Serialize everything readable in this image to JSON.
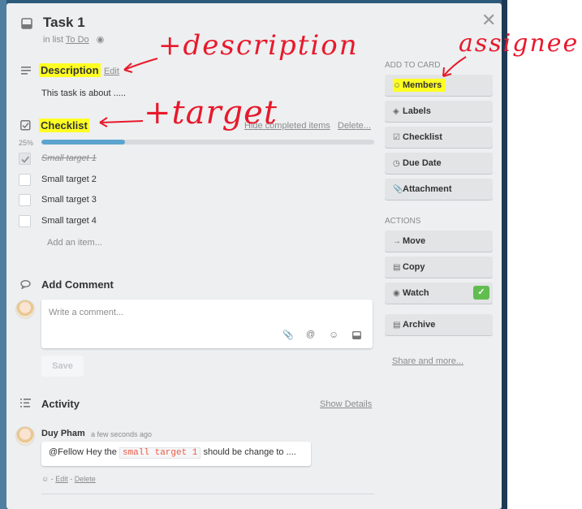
{
  "card": {
    "title": "Task 1",
    "in_list_prefix": "in list",
    "list_name": "To Do"
  },
  "description": {
    "heading": "Description",
    "edit_label": "Edit",
    "text": "This task is about ....."
  },
  "checklist": {
    "heading": "Checklist",
    "hide_completed_label": "Hide completed items",
    "delete_label": "Delete...",
    "progress_text": "25%",
    "progress_value": 0.25,
    "items": [
      {
        "label": "Small target 1",
        "checked": true
      },
      {
        "label": "Small target 2",
        "checked": false
      },
      {
        "label": "Small target 3",
        "checked": false
      },
      {
        "label": "Small target 4",
        "checked": false
      }
    ],
    "add_item_label": "Add an item..."
  },
  "add_comment": {
    "heading": "Add Comment",
    "placeholder": "Write a comment...",
    "save_label": "Save"
  },
  "activity": {
    "heading": "Activity",
    "show_details_label": "Show Details",
    "entry": {
      "author": "Duy Pham",
      "time": "a few seconds ago",
      "mention": "@Fellow",
      "text_before": " Hey the ",
      "code": "small target 1",
      "text_after": " should be change to ....",
      "edit_label": "Edit",
      "delete_label": "Delete"
    }
  },
  "sidebar": {
    "add_to_card_label": "ADD TO CARD",
    "add_buttons": [
      "Members",
      "Labels",
      "Checklist",
      "Due Date",
      "Attachment"
    ],
    "actions_label": "ACTIONS",
    "action_buttons": [
      "Move",
      "Copy",
      "Watch",
      "Archive"
    ],
    "share_label": "Share and more..."
  },
  "annotations": {
    "description": "+description",
    "target": "+target",
    "assignee": "assignee"
  },
  "colors": {
    "highlight": "#ffff22",
    "annotation": "#e8192c",
    "progress": "#5ba4cf",
    "watch_check": "#61bd4f",
    "board": "#2d5a7b"
  }
}
